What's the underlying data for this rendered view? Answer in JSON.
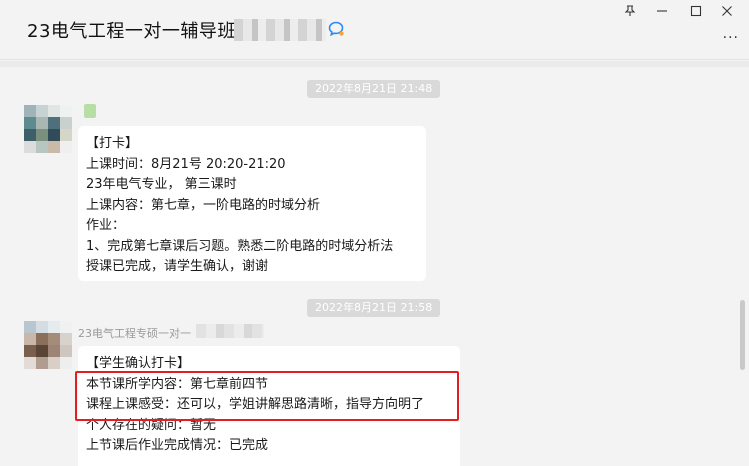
{
  "window": {
    "title": "23电气工程一对一辅导班",
    "controls": {
      "pin_icon": "pin-icon",
      "minimize_icon": "minimize-icon",
      "maximize_icon": "maximize-icon",
      "close_icon": "close-icon"
    },
    "more_label": "···"
  },
  "messages": [
    {
      "timestamp": "2022年8月21日 21:48",
      "sender": "",
      "lines": [
        "【打卡】",
        "上课时间：8月21号 20:20-21:20",
        "23年电气专业， 第三课时",
        "上课内容：第七章，一阶电路的时域分析",
        "作业：",
        "1、完成第七章课后习题。熟悉二阶电路的时域分析法",
        "授课已完成，请学生确认，谢谢"
      ]
    },
    {
      "timestamp": "2022年8月21日 21:58",
      "sender": "23电气工程专硕一对一",
      "lines": [
        "【学生确认打卡】",
        "本节课所学内容：第七章前四节",
        "课程上课感受：还可以，学姐讲解思路清晰，指导方向明了",
        "个人存在的疑问：暂无",
        "上节课后作业完成情况：已完成"
      ]
    }
  ],
  "colors": {
    "highlight": "#e02020",
    "bubble": "#ffffff",
    "background": "#f3f3f3"
  }
}
